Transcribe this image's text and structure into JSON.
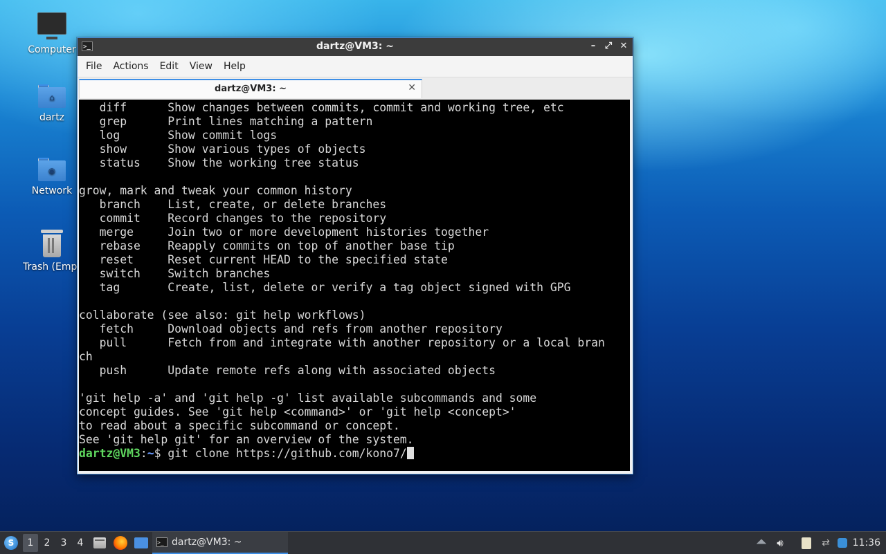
{
  "desktop": {
    "icons": [
      {
        "label": "Computer"
      },
      {
        "label": "dartz"
      },
      {
        "label": "Network"
      },
      {
        "label": "Trash (Empt"
      }
    ]
  },
  "window": {
    "title": "dartz@VM3: ~",
    "controls": {
      "minimize": "–",
      "maximize": "⤢",
      "close": "✕"
    },
    "menu": [
      "File",
      "Actions",
      "Edit",
      "View",
      "Help"
    ],
    "tab": {
      "label": "dartz@VM3: ~",
      "close": "✕"
    }
  },
  "terminal": {
    "lines": [
      "   diff      Show changes between commits, commit and working tree, etc",
      "   grep      Print lines matching a pattern",
      "   log       Show commit logs",
      "   show      Show various types of objects",
      "   status    Show the working tree status",
      "",
      "grow, mark and tweak your common history",
      "   branch    List, create, or delete branches",
      "   commit    Record changes to the repository",
      "   merge     Join two or more development histories together",
      "   rebase    Reapply commits on top of another base tip",
      "   reset     Reset current HEAD to the specified state",
      "   switch    Switch branches",
      "   tag       Create, list, delete or verify a tag object signed with GPG",
      "",
      "collaborate (see also: git help workflows)",
      "   fetch     Download objects and refs from another repository",
      "   pull      Fetch from and integrate with another repository or a local bran",
      "ch",
      "   push      Update remote refs along with associated objects",
      "",
      "'git help -a' and 'git help -g' list available subcommands and some",
      "concept guides. See 'git help <command>' or 'git help <concept>'",
      "to read about a specific subcommand or concept.",
      "See 'git help git' for an overview of the system."
    ],
    "prompt": {
      "user_host": "dartz@VM3",
      "separator": ":",
      "path": "~",
      "symbol": "$ ",
      "command": "git clone https://github.com/kono7/"
    }
  },
  "taskbar": {
    "workspaces": [
      "1",
      "2",
      "3",
      "4"
    ],
    "active_workspace": "1",
    "task_label": "dartz@VM3: ~",
    "clock": "11:36"
  }
}
